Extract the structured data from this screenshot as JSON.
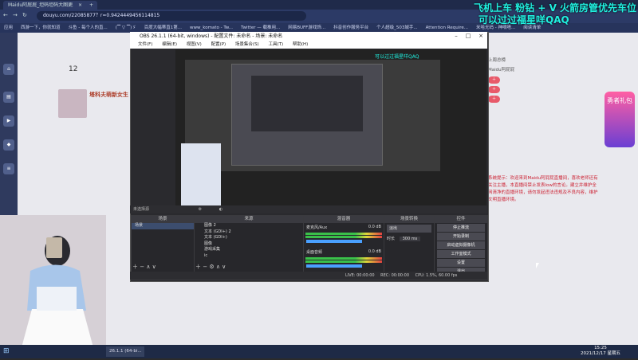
{
  "browser": {
    "tabs": [
      {
        "label": "Maidu阿屁屁_坦码坦码大图更..."
      },
      {
        "label": ""
      },
      {
        "label": ""
      }
    ],
    "url": "douyu.com/22085877？r=0.9424449456114815",
    "bookmarks": [
      "应用",
      "西游一下，你就知道",
      "斗鱼 - 每个人的直...",
      "(▔ ▽ ▔)ゞ",
      "百度大幅蒂直1第...",
      "www_komato - Tw...",
      "Twitter — 载推用...",
      "网易BUFF游戏饰...",
      "抖音创作服务平台",
      "个人超级_503城手...",
      "Attention Require...",
      "米哈无码 - 神嘀嗒...",
      "阅读清单"
    ]
  },
  "overlay": {
    "line1": "飞机上车 粉钻 + V 火箭房管优先车位",
    "line2": "可以过过福星咩QAQ"
  },
  "page": {
    "count": "12",
    "streamer_name": "塔科夫萌新女生",
    "right_lines": [
      "上周总榜",
      "Maidu阿屁屁",
      "",
      "",
      ""
    ],
    "chat_text": "系统提示：欢迎来到Maidu阿屁屁直播间，喜欢老师还有关注主播，本直播间禁止发表low的言论。建立并维护全网清净的直播环境，请勿发起违法违规及不良内容，维护文明直播环境。",
    "badge_text": "勇者礼包"
  },
  "obs": {
    "title": "OBS 26.1.1 (64-bit, windows) - 配置文件: 未命名 - 场景: 未命名",
    "menu": [
      "文件(F)",
      "编辑(E)",
      "视图(V)",
      "配置(P)",
      "场景集合(S)",
      "工具(T)",
      "帮助(H)"
    ],
    "scenes_header": "场景",
    "scenes": [
      "场景"
    ],
    "sources_header": "来源",
    "sources": [
      "图像 2",
      "文本 (GDI+) 2",
      "文本 (GDI+)",
      "图像",
      "游戏采集",
      "ic"
    ],
    "mixer_header": "混音器",
    "mixer": [
      {
        "name": "麦克风/Aux",
        "db": "0.0 dB"
      },
      {
        "name": "桌面音频",
        "db": "0.0 dB"
      }
    ],
    "transitions_header": "场景转换",
    "transition_type": "淡出",
    "duration_label": "时长",
    "duration_value": "300 ms",
    "controls_header": "控件",
    "controls": [
      "停止推流",
      "开始录制",
      "启动虚拟摄像机",
      "工作室模式",
      "设置",
      "退出"
    ],
    "no_source": "未选择源",
    "status": {
      "live": "LIVE: 00:00:00",
      "rec": "REC: 00:00:00",
      "cpu": "CPU: 1.5%, 60.00 fps"
    }
  },
  "taskbar": {
    "item": "26.1.1 (64-bi...",
    "time": "15:25",
    "date": "2021/12/17 星期五"
  }
}
